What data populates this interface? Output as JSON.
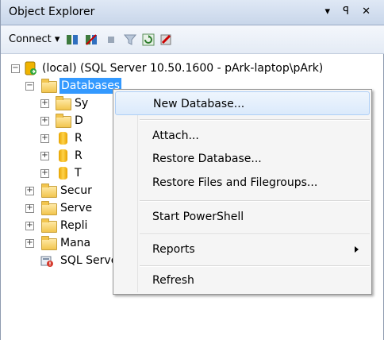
{
  "panel": {
    "title": "Object Explorer",
    "window_controls": "▾ ꟼ ✕",
    "toolbar": {
      "connect_label": "Connect ▾"
    }
  },
  "tree": {
    "server_label": "(local) (SQL Server 10.50.1600 - pArk-laptop\\pArk)",
    "databases_label": "Databases",
    "children": [
      "Sy",
      "D",
      "R",
      "R",
      "T"
    ],
    "top_folders": [
      "Secur",
      "Serve",
      "Repli",
      "Mana"
    ],
    "agent_label": "SQL Server Agent (Agent XPs disabled)"
  },
  "context_menu": {
    "items": [
      "New Database...",
      "Attach...",
      "Restore Database...",
      "Restore Files and Filegroups...",
      "Start PowerShell",
      "Reports",
      "Refresh"
    ]
  }
}
